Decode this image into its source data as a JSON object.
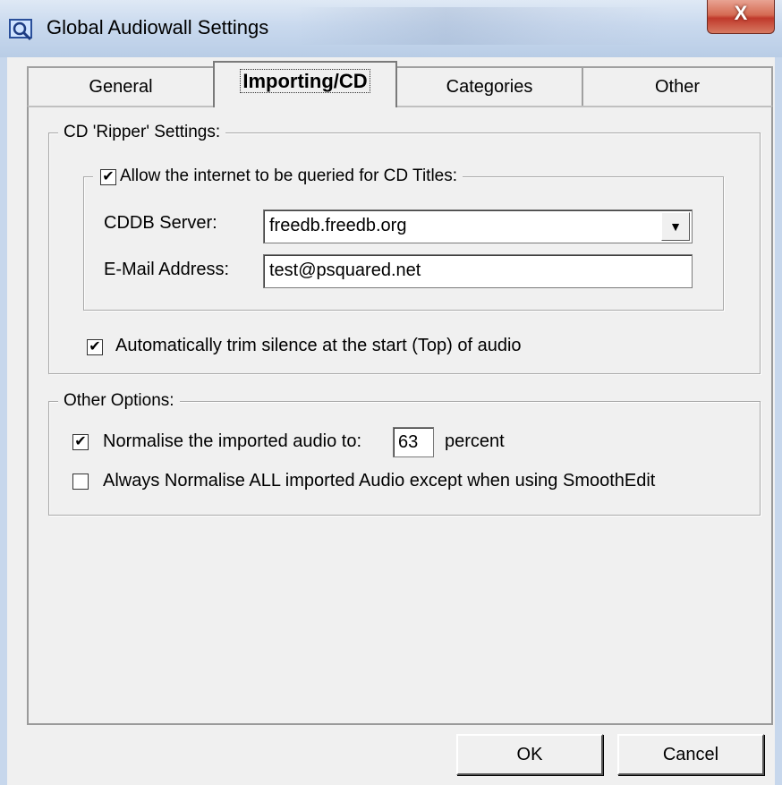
{
  "window": {
    "title": "Global Audiowall Settings",
    "close_glyph": "X"
  },
  "tabs": [
    {
      "label": "General",
      "active": false
    },
    {
      "label": "Importing/CD",
      "active": true
    },
    {
      "label": "Categories",
      "active": false
    },
    {
      "label": "Other",
      "active": false
    }
  ],
  "ripper": {
    "legend": "CD 'Ripper' Settings:",
    "internet": {
      "label": "Allow the internet to be queried for CD Titles:",
      "checked": true,
      "cddb_label": "CDDB Server:",
      "cddb_value": "freedb.freedb.org",
      "email_label": "E-Mail Address:",
      "email_value": "test@psquared.net"
    },
    "trim": {
      "label": "Automatically trim silence at the start (Top) of audio",
      "checked": true
    }
  },
  "other": {
    "legend": "Other Options:",
    "normalise": {
      "label_before": "Normalise the imported  audio to:",
      "value": "63",
      "label_after": "percent",
      "checked": true
    },
    "always": {
      "label": "Always Normalise ALL imported Audio except when using SmoothEdit",
      "checked": false
    }
  },
  "buttons": {
    "ok": "OK",
    "cancel": "Cancel"
  },
  "check_glyph": "✔",
  "dropdown_glyph": "▼"
}
